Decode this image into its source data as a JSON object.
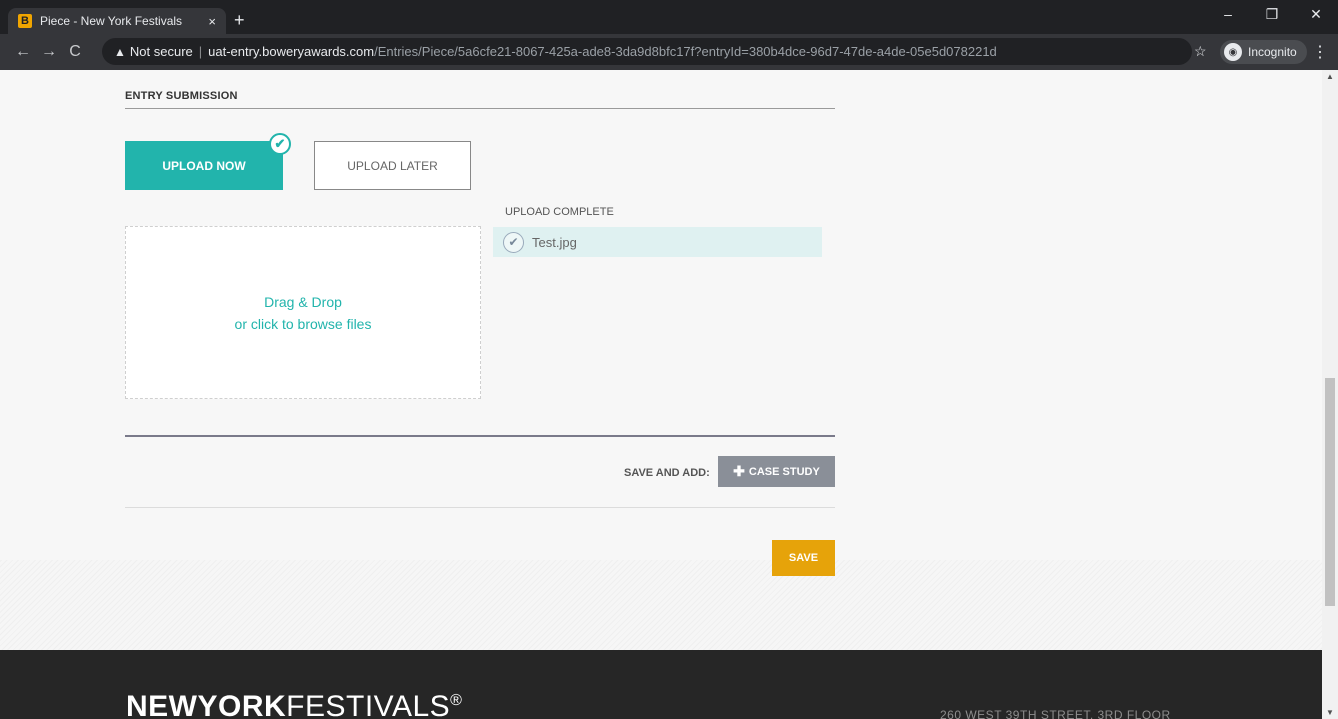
{
  "browser": {
    "tab_title": "Piece - New York Festivals",
    "tab_favicon": "B",
    "tab_close": "×",
    "new_tab": "+",
    "window_controls": [
      "–",
      "❐",
      "✕"
    ],
    "nav": {
      "back": "←",
      "forward": "→",
      "reload": "C"
    },
    "security_label": "Not secure",
    "url_domain": "uat-entry.boweryawards.com",
    "url_path": "/Entries/Piece/5a6cfe21-8067-425a-ade8-3da9d8bfc17f?entryId=380b4dce-96d7-47de-a4de-05e5d078221d",
    "incognito_label": "Incognito",
    "icons": {
      "star": "star-icon",
      "incognito": "incognito-icon",
      "menu": "kebab-menu-icon"
    }
  },
  "section": {
    "title": "ENTRY SUBMISSION"
  },
  "upload_mode": {
    "now_label": "UPLOAD NOW",
    "later_label": "UPLOAD LATER",
    "selected": "now"
  },
  "dropzone": {
    "line1": "Drag & Drop",
    "line2": "or click to browse files"
  },
  "upload": {
    "status_label": "UPLOAD COMPLETE",
    "files": [
      {
        "name": "Test.jpg"
      }
    ]
  },
  "actions": {
    "save_and_add_label": "SAVE AND ADD:",
    "case_study_label": "CASE STUDY",
    "save_label": "SAVE"
  },
  "footer": {
    "logo_bold": "NEWYORK",
    "logo_light": "FESTIVALS",
    "logo_mark": "®",
    "address": "260 WEST 39TH STREET, 3RD FLOOR"
  },
  "colors": {
    "accent_teal": "#22b4ac",
    "save_yellow": "#e6a30a",
    "case_study_gray": "#8a8f98",
    "footer_bg": "#262626"
  }
}
